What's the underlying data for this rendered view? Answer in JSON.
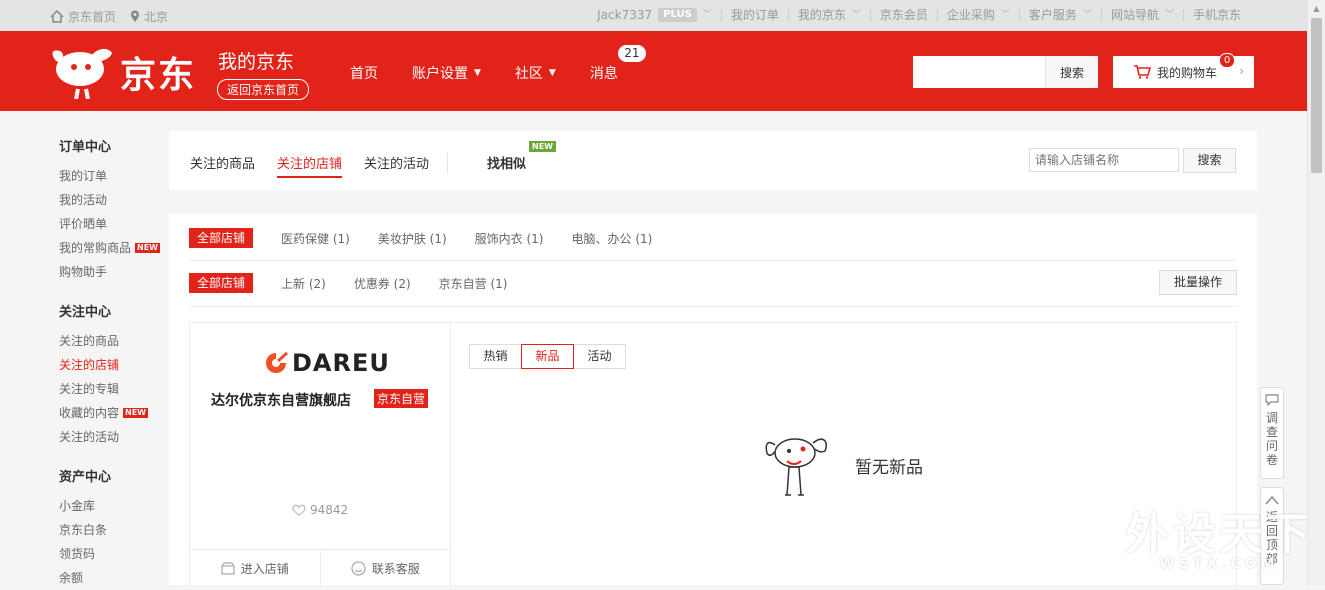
{
  "topbar": {
    "home": "京东首页",
    "location": "北京",
    "user": "Jack7337",
    "plus": "PLUS",
    "links": [
      "我的订单",
      "我的京东",
      "京东会员",
      "企业采购",
      "客户服务",
      "网站导航",
      "手机京东"
    ]
  },
  "header": {
    "logo_text": "京东",
    "title": "我的京东",
    "back_home": "返回京东首页",
    "nav": [
      {
        "label": "首页",
        "caret": false
      },
      {
        "label": "账户设置",
        "caret": true
      },
      {
        "label": "社区",
        "caret": true
      },
      {
        "label": "消息",
        "caret": false
      }
    ],
    "message_count": "21",
    "search_button": "搜索",
    "cart_label": "我的购物车",
    "cart_count": "0"
  },
  "sidebar": {
    "groups": [
      {
        "title": "订单中心",
        "items": [
          {
            "label": "我的订单",
            "new": false,
            "active": false
          },
          {
            "label": "我的活动",
            "new": false,
            "active": false
          },
          {
            "label": "评价晒单",
            "new": false,
            "active": false
          },
          {
            "label": "我的常购商品",
            "new": true,
            "active": false
          },
          {
            "label": "购物助手",
            "new": false,
            "active": false
          }
        ]
      },
      {
        "title": "关注中心",
        "items": [
          {
            "label": "关注的商品",
            "new": false,
            "active": false
          },
          {
            "label": "关注的店铺",
            "new": false,
            "active": true
          },
          {
            "label": "关注的专辑",
            "new": false,
            "active": false
          },
          {
            "label": "收藏的内容",
            "new": true,
            "active": false
          },
          {
            "label": "关注的活动",
            "new": false,
            "active": false
          }
        ]
      },
      {
        "title": "资产中心",
        "items": [
          {
            "label": "小金库",
            "new": false,
            "active": false
          },
          {
            "label": "京东白条",
            "new": false,
            "active": false
          },
          {
            "label": "领货码",
            "new": false,
            "active": false
          },
          {
            "label": "余额",
            "new": false,
            "active": false
          }
        ]
      }
    ],
    "new_tag": "NEW"
  },
  "tabs": {
    "items": [
      "关注的商品",
      "关注的店铺",
      "关注的活动"
    ],
    "active_index": 1,
    "find_similar": "找相似",
    "new_tag": "NEW",
    "search_placeholder": "请输入店铺名称",
    "search_button": "搜索"
  },
  "filters": {
    "row1": [
      "全部店铺",
      "医药保健 (1)",
      "美妆护肤 (1)",
      "服饰内衣 (1)",
      "电脑、办公 (1)"
    ],
    "row2": [
      "全部店铺",
      "上新 (2)",
      "优惠券 (2)",
      "京东自营 (1)"
    ],
    "batch": "批量操作"
  },
  "store": {
    "brand": "DAREU",
    "name": "达尔优京东自营旗舰店",
    "self_tag": "京东自营",
    "follow_count": "94842",
    "enter": "进入店铺",
    "service": "联系客服",
    "subtabs": [
      "热销",
      "新品",
      "活动"
    ],
    "active_subtab": 1,
    "empty_text": "暂无新品"
  },
  "side_tools": {
    "survey": "调查问卷",
    "to_top": "返回顶部"
  },
  "watermark": {
    "main": "外设天下",
    "sub": "WSTX.COM"
  },
  "colors": {
    "brand_red": "#e2231a",
    "new_green": "#6aa837"
  }
}
